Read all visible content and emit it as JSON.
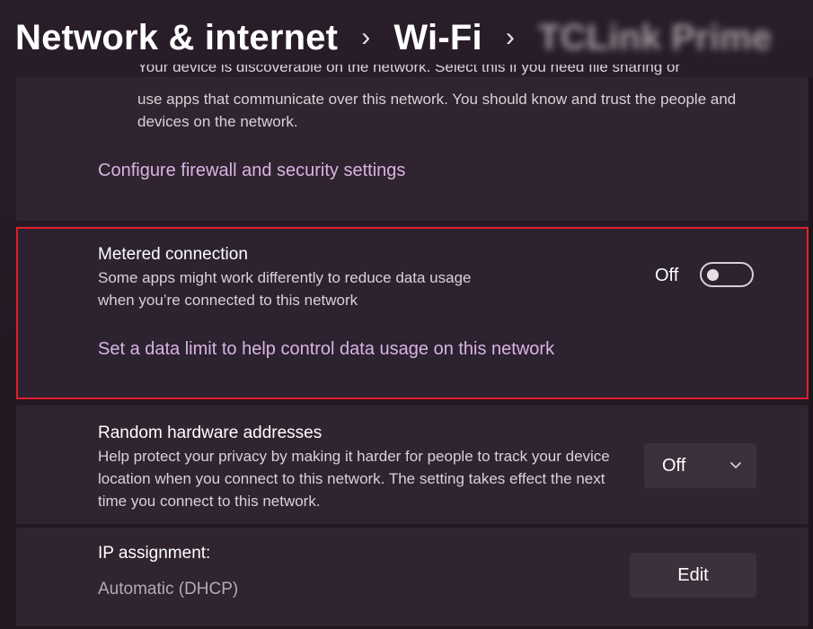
{
  "breadcrumb": {
    "items": [
      "Network & internet",
      "Wi-Fi",
      "TCLink Prime"
    ],
    "separator": "›"
  },
  "top_section": {
    "partial_line": "Your device is discoverable on the network. Select this if you need file sharing or",
    "description": "use apps that communicate over this network. You should know and trust the people and devices on the network.",
    "firewall_link": "Configure firewall and security settings"
  },
  "metered": {
    "title": "Metered connection",
    "description": "Some apps might work differently to reduce data usage when you’re connected to this network",
    "state_label": "Off",
    "data_limit_link": "Set a data limit to help control data usage on this network"
  },
  "random_hw": {
    "title": "Random hardware addresses",
    "description": "Help protect your privacy by making it harder for people to track your device location when you connect to this network. The setting takes effect the next time you connect to this network.",
    "selected": "Off"
  },
  "ip": {
    "title": "IP assignment:",
    "value": "Automatic (DHCP)",
    "edit_label": "Edit"
  },
  "colors": {
    "link": "#d8b4e2",
    "highlight": "#e0202a",
    "card": "#2f242f",
    "button": "#3b303b"
  },
  "icons": {
    "toggle": "toggle-switch-off",
    "dropdown": "chevron-down-icon",
    "breadcrumb_separator": "chevron-right-icon"
  }
}
